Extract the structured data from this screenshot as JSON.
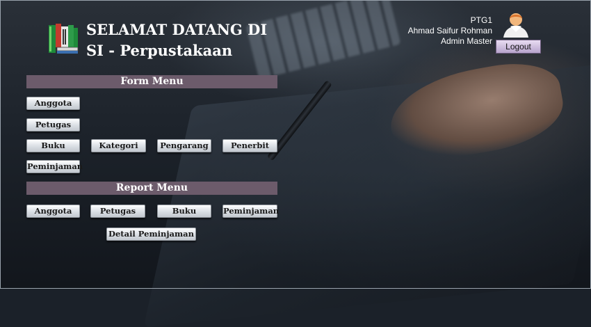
{
  "header": {
    "title_line1": "SELAMAT DATANG DI",
    "title_line2": "SI - Perpustakaan"
  },
  "user": {
    "id": "PTG1",
    "name": "Ahmad Saifur Rohman",
    "role": "Admin Master",
    "logout_label": "Logout"
  },
  "form_menu": {
    "title": "Form Menu",
    "items": [
      "Anggota",
      "Petugas",
      "Buku",
      "Kategori",
      "Pengarang",
      "Penerbit",
      "Peminjaman"
    ]
  },
  "report_menu": {
    "title": "Report Menu",
    "items": [
      "Anggota",
      "Petugas",
      "Buku",
      "Peminjaman",
      "Detail Peminjaman"
    ]
  },
  "icons": [
    "books-logo-icon",
    "user-avatar-icon"
  ]
}
